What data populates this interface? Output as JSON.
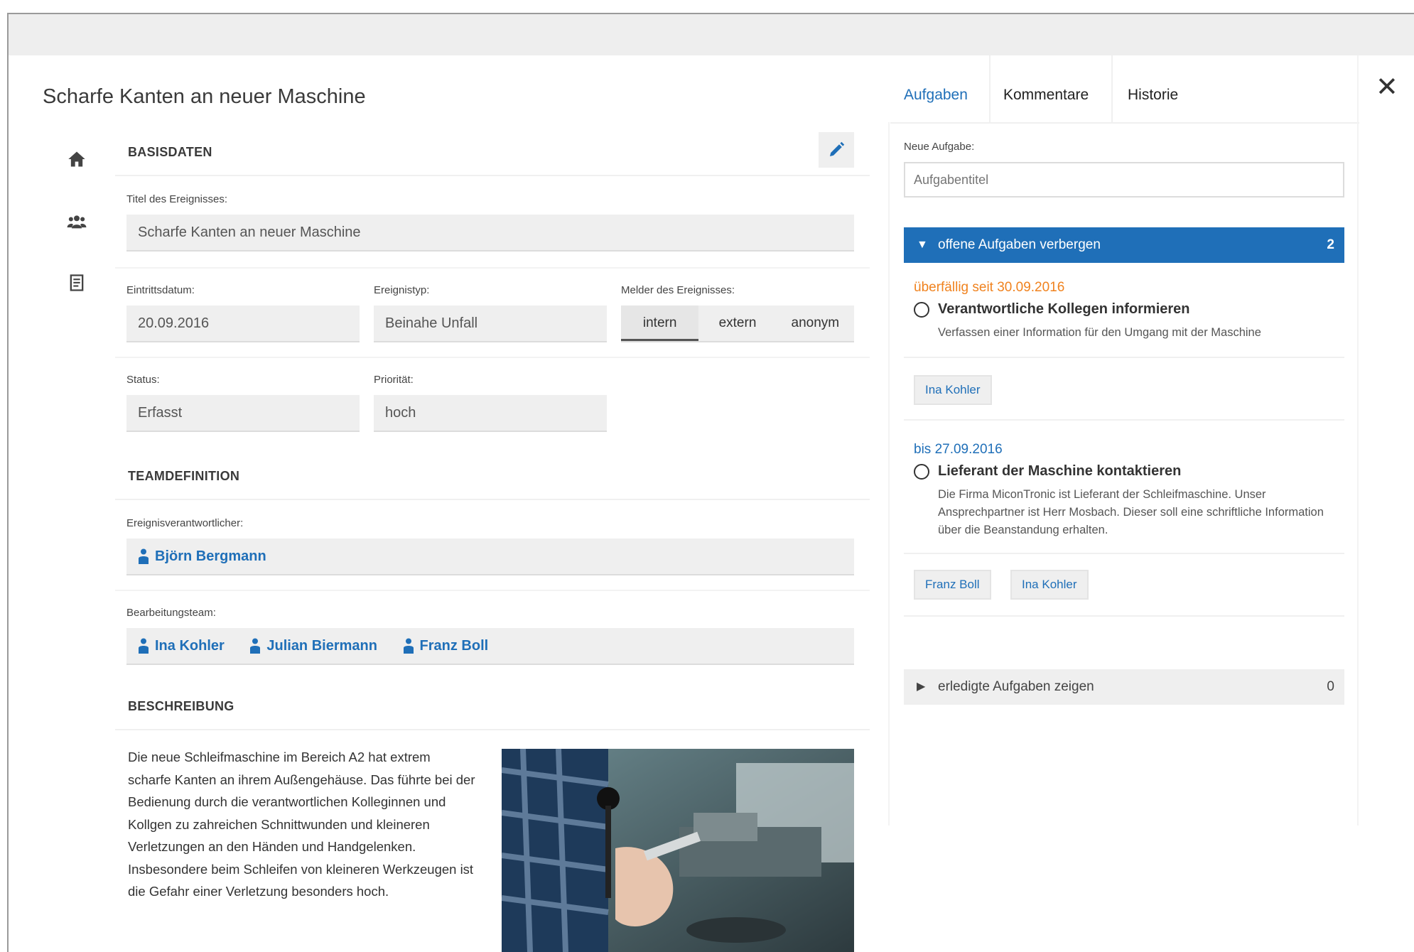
{
  "window": {
    "title": "Scharfe Kanten an neuer Maschine",
    "close_glyph": "✕"
  },
  "sidebar": {
    "icons": [
      "home-icon",
      "team-icon",
      "document-icon"
    ]
  },
  "basisdaten": {
    "heading": "BASISDATEN",
    "titel_label": "Titel des Ereignisses:",
    "titel_value": "Scharfe Kanten an neuer Maschine",
    "datum_label": "Eintrittsdatum:",
    "datum_value": "20.09.2016",
    "typ_label": "Ereignistyp:",
    "typ_value": "Beinahe Unfall",
    "melder_label": "Melder des Ereignisses:",
    "melder_options": [
      "intern",
      "extern",
      "anonym"
    ],
    "melder_selected": "intern",
    "status_label": "Status:",
    "status_value": "Erfasst",
    "prio_label": "Priorität:",
    "prio_value": "hoch"
  },
  "team": {
    "heading": "TEAMDEFINITION",
    "verantwortlich_label": "Ereignisverantwortlicher:",
    "verantwortlich": "Björn Bergmann",
    "bearbeitung_label": "Bearbeitungsteam:",
    "members": [
      "Ina Kohler",
      "Julian Biermann",
      "Franz Boll"
    ]
  },
  "beschreibung": {
    "heading": "BESCHREIBUNG",
    "text": "Die neue Schleifmaschine im Bereich A2 hat extrem scharfe Kanten an ihrem Außengehäuse. Das führte bei der Bedienung durch die verantwortlichen Kolleginnen und Kollgen zu zahreichen Schnittwunden und kleineren Verletzungen an den Händen und Handgelenken. Insbesondere beim Schleifen von kleineren Werkzeugen ist die Gefahr einer Verletzung besonders hoch."
  },
  "tabs": {
    "aufgaben": "Aufgaben",
    "kommentare": "Kommentare",
    "historie": "Historie",
    "active": "aufgaben",
    "active_color": "#1f6fb8"
  },
  "aufgaben": {
    "neue_label": "Neue Aufgabe:",
    "input_placeholder": "Aufgabentitel",
    "open_toggle_label": "offene Aufgaben verbergen",
    "open_count": "2",
    "tasks": [
      {
        "due": "überfällig seit 30.09.2016",
        "title": "Verantwortliche Kollegen informieren",
        "description": "Verfassen einer Information für den Umgang mit der Maschine",
        "assignees": [
          "Ina Kohler"
        ]
      },
      {
        "due": "bis 27.09.2016",
        "title": "Lieferant der Maschine kontaktieren",
        "description": "Die Firma MiconTronic ist Lieferant der Schleifmaschine. Unser Ansprechpartner ist Herr Mosbach. Dieser soll eine schriftliche Information über die Beanstandung erhalten.",
        "assignees": [
          "Franz Boll",
          "Ina Kohler"
        ]
      }
    ],
    "done_toggle_label": "erledigte Aufgaben zeigen",
    "done_count": "0",
    "overdue_color": "#f0821e",
    "accent_color": "#1f6fb8"
  }
}
